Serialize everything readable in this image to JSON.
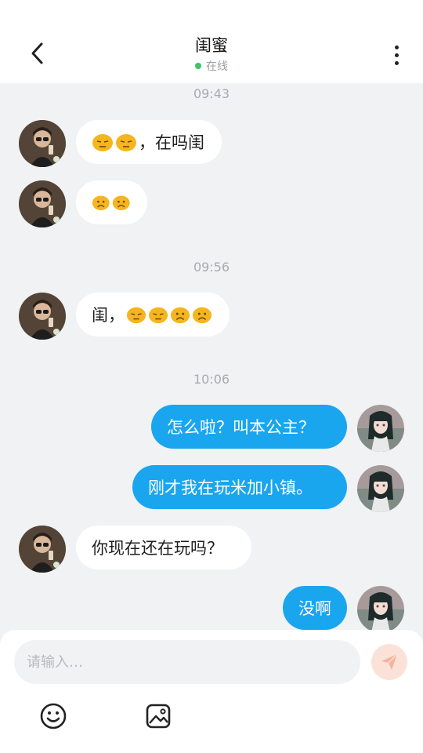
{
  "header": {
    "title": "闺蜜",
    "status": "在线",
    "status_color": "#3bc46a",
    "back_icon": "chevron-left-icon",
    "more_icon": "more-vertical-icon"
  },
  "timestamps": [
    "09:43",
    "09:56",
    "10:06"
  ],
  "messages": [
    {
      "from": "friend",
      "emojis": [
        "expressionless",
        "expressionless"
      ],
      "text": "，在吗闺"
    },
    {
      "from": "friend",
      "emojis": [
        "frowning",
        "frowning"
      ],
      "text": ""
    },
    {
      "from": "friend",
      "text_before": "闺，",
      "emojis": [
        "expressionless",
        "expressionless",
        "frowning",
        "frowning"
      ]
    },
    {
      "from": "me",
      "text": "怎么啦？叫本公主？"
    },
    {
      "from": "me",
      "text": "刚才我在玩米加小镇。"
    },
    {
      "from": "friend",
      "text": "你现在还在玩吗？"
    },
    {
      "from": "me",
      "text": "没啊"
    }
  ],
  "input": {
    "placeholder": "请输入…",
    "value": ""
  },
  "toolbar": {
    "emoji_icon": "smiley-icon",
    "image_icon": "image-icon",
    "send_icon": "send-icon"
  },
  "colors": {
    "outgoing_bubble": "#1aa5ef",
    "incoming_bubble": "#ffffff",
    "background": "#f1f2f4",
    "send_button": "#fbe2d8"
  }
}
